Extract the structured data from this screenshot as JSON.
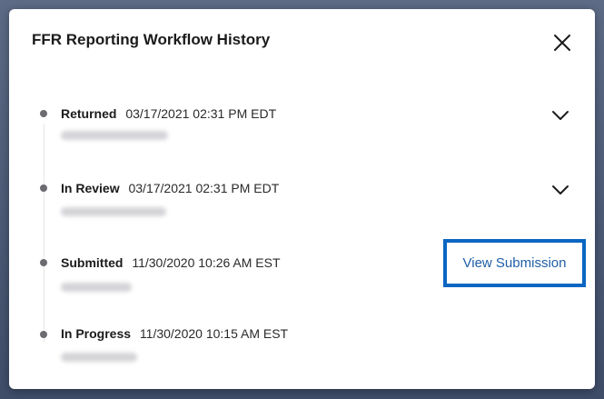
{
  "modal": {
    "title": "FFR Reporting Workflow History",
    "close_icon": "close-icon",
    "entries": [
      {
        "status": "Returned",
        "timestamp": "03/17/2021 02:31 PM EDT",
        "expand_icon": "chevron-down-icon"
      },
      {
        "status": "In Review",
        "timestamp": "03/17/2021 02:31 PM EDT",
        "expand_icon": "chevron-down-icon"
      },
      {
        "status": "Submitted",
        "timestamp": "11/30/2020 10:26 AM EST",
        "action_label": "View Submission"
      },
      {
        "status": "In Progress",
        "timestamp": "11/30/2020 10:15 AM EST"
      }
    ]
  },
  "colors": {
    "accent": "#0a66c2",
    "link_text": "#1e5ea8",
    "dot": "#6b6b70",
    "backdrop": "#4a5872"
  }
}
